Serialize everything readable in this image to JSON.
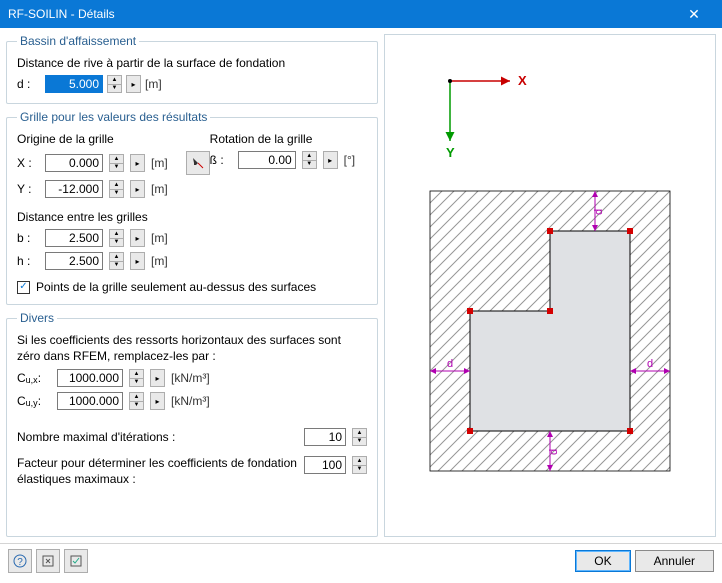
{
  "window": {
    "title": "RF-SOILIN - Détails",
    "close": "✕"
  },
  "bassin": {
    "legend": "Bassin d'affaissement",
    "line1": "Distance de rive à partir de la surface de fondation",
    "d_label": "d :",
    "d_value": "5.000",
    "d_unit": "[m]"
  },
  "grid": {
    "legend": "Grille pour les valeurs des résultats",
    "origin_label": "Origine de la grille",
    "rotation_label": "Rotation de la grille",
    "x_label": "X :",
    "x_value": "0.000",
    "x_unit": "[m]",
    "beta_label": "ß :",
    "beta_value": "0.00",
    "beta_unit": "[°]",
    "y_label": "Y :",
    "y_value": "-12.000",
    "y_unit": "[m]",
    "dist_label": "Distance entre les grilles",
    "b_label": "b :",
    "b_value": "2.500",
    "b_unit": "[m]",
    "h_label": "h :",
    "h_value": "2.500",
    "h_unit": "[m]",
    "check_label": "Points de la grille seulement au-dessus des surfaces"
  },
  "divers": {
    "legend": "Divers",
    "horiz_text": "Si les coefficients des ressorts horizontaux des surfaces sont zéro dans RFEM, remplacez-les par :",
    "cux_label_a": "C",
    "cux_label_b": "u,x",
    "cux_label_c": ":",
    "cux_value": "1000.000",
    "cux_unit": "[kN/m³]",
    "cuy_label_a": "C",
    "cuy_label_b": "u,y",
    "cuy_label_c": ":",
    "cuy_value": "1000.000",
    "cuy_unit": "[kN/m³]",
    "iter_label": "Nombre maximal d'itérations :",
    "iter_value": "10",
    "factor_label": "Facteur pour déterminer les coefficients de fondation élastiques maximaux :",
    "factor_value": "100"
  },
  "preview": {
    "axis_x_text": "X",
    "axis_y_text": "Y",
    "dim_text": "d",
    "colors": {
      "axis_x": "#c80000",
      "axis_y": "#009a00",
      "dim": "#b000b0",
      "node": "#d40000",
      "fill": "#dfe1e4",
      "hatch": "#969696"
    }
  },
  "footer": {
    "ok": "OK",
    "cancel": "Annuler"
  }
}
